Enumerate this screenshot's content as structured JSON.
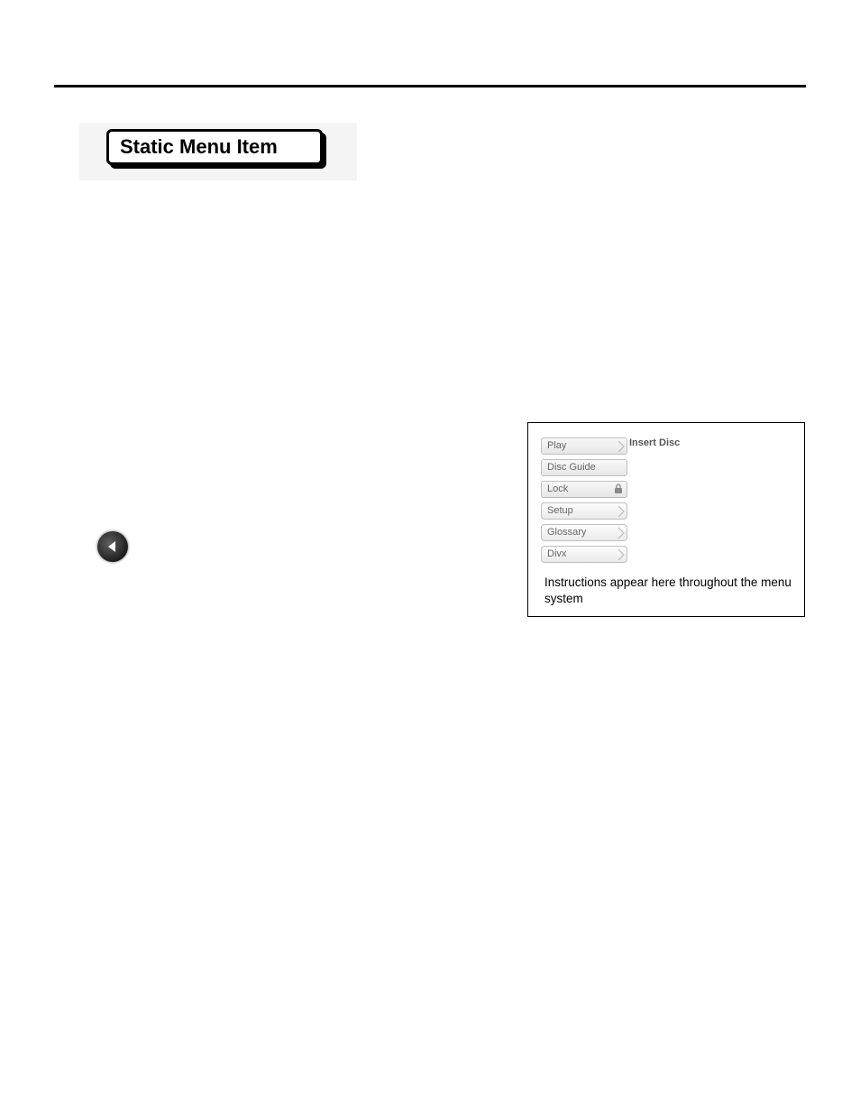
{
  "chip": {
    "label": "Static Menu Item"
  },
  "screenshot": {
    "status": "Insert Disc",
    "menu": [
      {
        "label": "Play",
        "style": "flat arrow"
      },
      {
        "label": "Disc Guide",
        "style": "flat noarrow"
      },
      {
        "label": "Lock",
        "style": "flat lock noarrow"
      },
      {
        "label": "Setup",
        "style": "arrow"
      },
      {
        "label": "Glossary",
        "style": "arrow"
      },
      {
        "label": "Divx",
        "style": "arrow"
      }
    ],
    "caption": "Instructions appear here throughout the menu system"
  }
}
